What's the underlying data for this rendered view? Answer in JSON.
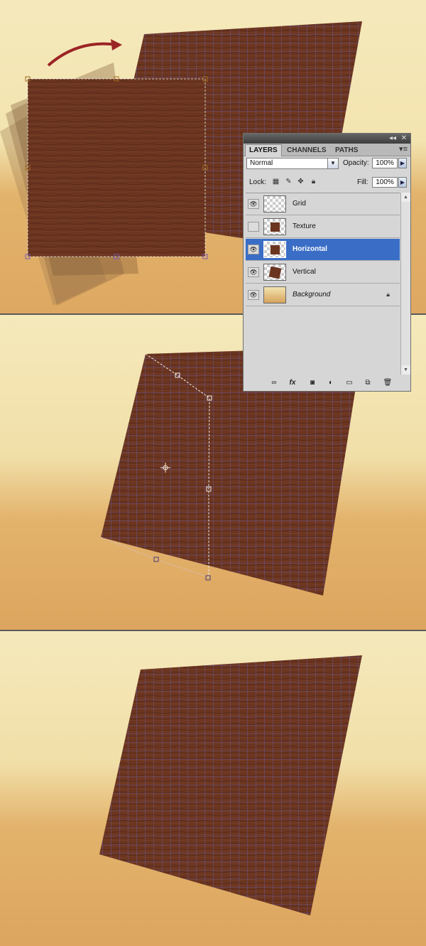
{
  "layers_panel": {
    "tabs": [
      "LAYERS",
      "CHANNELS",
      "PATHS"
    ],
    "active_tab": "LAYERS",
    "blend_mode": "Normal",
    "opacity_label": "Opacity:",
    "opacity_value": "100%",
    "lock_label": "Lock:",
    "fill_label": "Fill:",
    "fill_value": "100%",
    "layers": [
      {
        "name": "Grid",
        "visible": true,
        "thumb": "transparent-grid"
      },
      {
        "name": "Texture",
        "visible": false,
        "thumb": "wood-square"
      },
      {
        "name": "Horizontal",
        "visible": true,
        "thumb": "wood-square",
        "selected": true
      },
      {
        "name": "Vertical",
        "visible": true,
        "thumb": "wood-square-rotated"
      },
      {
        "name": "Background",
        "visible": true,
        "thumb": "gradient",
        "locked": true
      }
    ]
  },
  "colors": {
    "wood": "#6b3520",
    "grid_line": "#6a6ad0",
    "arrow": "#9b2424",
    "selection_blue": "#3a6ec6"
  }
}
